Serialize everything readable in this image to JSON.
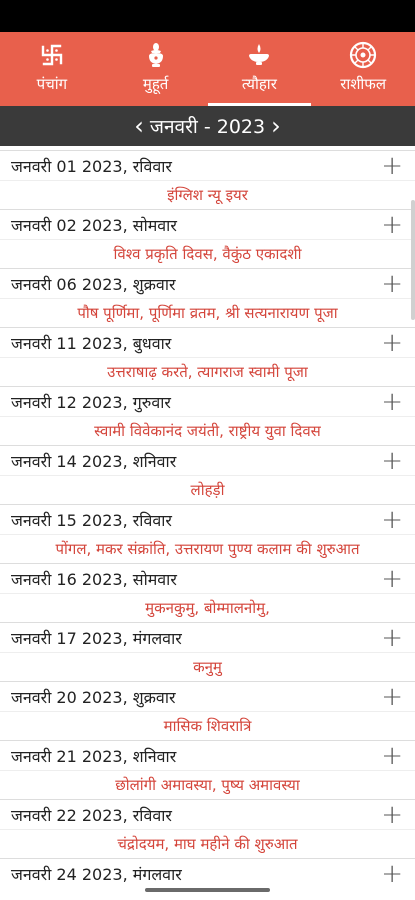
{
  "tabs": [
    {
      "label": "पंचांग",
      "icon": "swastika-icon"
    },
    {
      "label": "मुहूर्त",
      "icon": "kalash-icon"
    },
    {
      "label": "त्यौहार",
      "icon": "diya-icon",
      "active": true
    },
    {
      "label": "राशीफल",
      "icon": "zodiac-wheel-icon"
    }
  ],
  "month": {
    "label": "जनवरी - 2023",
    "prev_icon": "chevron-left-icon",
    "next_icon": "chevron-right-icon"
  },
  "entries": [
    {
      "date": "जनवरी 01 2023, रविवार",
      "festival": "इंग्लिश न्यू इयर"
    },
    {
      "date": "जनवरी 02 2023, सोमवार",
      "festival": "विश्व प्रकृति दिवस, वैकुंठ एकादशी"
    },
    {
      "date": "जनवरी 06 2023, शुक्रवार",
      "festival": "पौष पूर्णिमा, पूर्णिमा व्रतम, श्री सत्यनारायण पूजा"
    },
    {
      "date": "जनवरी 11 2023, बुधवार",
      "festival": "उत्तराषाढ़ करते, त्यागराज स्वामी पूजा"
    },
    {
      "date": "जनवरी 12 2023, गुरुवार",
      "festival": "स्वामी विवेकानंद जयंती, राष्ट्रीय युवा दिवस"
    },
    {
      "date": "जनवरी 14 2023, शनिवार",
      "festival": "लोहड़ी"
    },
    {
      "date": "जनवरी 15 2023, रविवार",
      "festival": "पोंगल, मकर संक्रांति, उत्तरायण पुण्य कलाम की शुरुआत"
    },
    {
      "date": "जनवरी 16 2023, सोमवार",
      "festival": "मुकनकुमु, बोम्मालनोमु,"
    },
    {
      "date": "जनवरी 17 2023, मंगलवार",
      "festival": "कनुमु"
    },
    {
      "date": "जनवरी 20 2023, शुक्रवार",
      "festival": "मासिक शिवरात्रि"
    },
    {
      "date": "जनवरी 21 2023, शनिवार",
      "festival": "छोलांगी अमावस्या, पुष्य अमावस्या"
    },
    {
      "date": "जनवरी 22 2023, रविवार",
      "festival": "चंद्रोदयम, माघ महीने की शुरुआत"
    },
    {
      "date": "जनवरी 24 2023, मंगलवार",
      "festival": ""
    }
  ],
  "expand_icon": "plus-icon",
  "colors": {
    "accent": "#e8604c",
    "month_bar": "#3a3a3a",
    "festival_text": "#d4453b"
  }
}
